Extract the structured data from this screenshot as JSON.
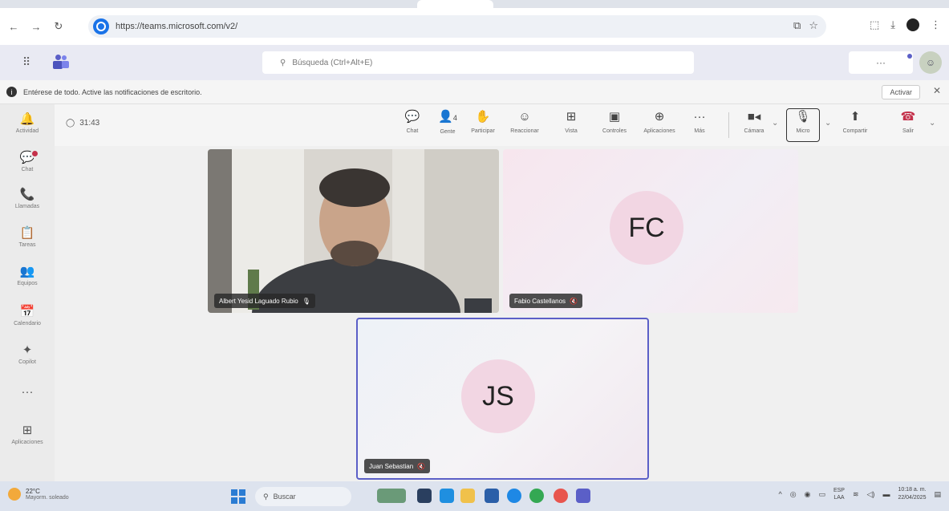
{
  "browser": {
    "url": "https://teams.microsoft.com/v2/",
    "nav": {
      "back": "←",
      "forward": "→",
      "reload": "↻"
    }
  },
  "teams_header": {
    "search_placeholder": "Búsqueda (Ctrl+Alt+E)",
    "more_label": "···"
  },
  "banner": {
    "text": "Entérese de todo. Active las notificaciones de escritorio.",
    "action_label": "Activar"
  },
  "rail": {
    "items": [
      {
        "label": "Actividad",
        "icon": "bell-icon",
        "glyph": "🔔"
      },
      {
        "label": "Chat",
        "icon": "chat-icon",
        "glyph": "💬",
        "has_badge": true
      },
      {
        "label": "Llamadas",
        "icon": "phone-icon",
        "glyph": "📞"
      },
      {
        "label": "Tareas",
        "icon": "tasks-icon",
        "glyph": "📋"
      },
      {
        "label": "Equipos",
        "icon": "teams-icon",
        "glyph": "👥"
      },
      {
        "label": "Calendario",
        "icon": "calendar-icon",
        "glyph": "📅"
      },
      {
        "label": "Copilot",
        "icon": "copilot-icon",
        "glyph": "✦"
      },
      {
        "label": "",
        "icon": "more-icon",
        "glyph": "···"
      },
      {
        "label": "Aplicaciones",
        "icon": "apps-icon",
        "glyph": "⊞"
      }
    ]
  },
  "meeting": {
    "timer": "31:43",
    "controls": {
      "chat": "Chat",
      "people": "Gente",
      "people_count": "4",
      "raise": "Participar",
      "react": "Reaccionar",
      "view": "Vista",
      "notes": "Controles",
      "apps": "Aplicaciones",
      "more": "Más",
      "camera": "Cámara",
      "mic": "Micro",
      "share": "Compartir",
      "leave": "Salir"
    }
  },
  "participants": [
    {
      "name": "Albert Yesid Laguado Rubio",
      "type": "video"
    },
    {
      "name": "Fabio Castellanos",
      "initials": "FC",
      "type": "avatar"
    },
    {
      "name": "Juan Sebastian",
      "initials": "JS",
      "type": "avatar",
      "active_speaker": true
    }
  ],
  "taskbar": {
    "weather_temp": "22°C",
    "weather_desc": "Mayorm. soleado",
    "search_placeholder": "Buscar",
    "lang_top": "ESP",
    "lang_bottom": "LAA",
    "time": "10:18 a. m.",
    "date": "22/04/2025"
  },
  "colors": {
    "accent": "#5b5fc7",
    "leave_red": "#c4314b",
    "avatar_bg": "#f2d6e3"
  }
}
